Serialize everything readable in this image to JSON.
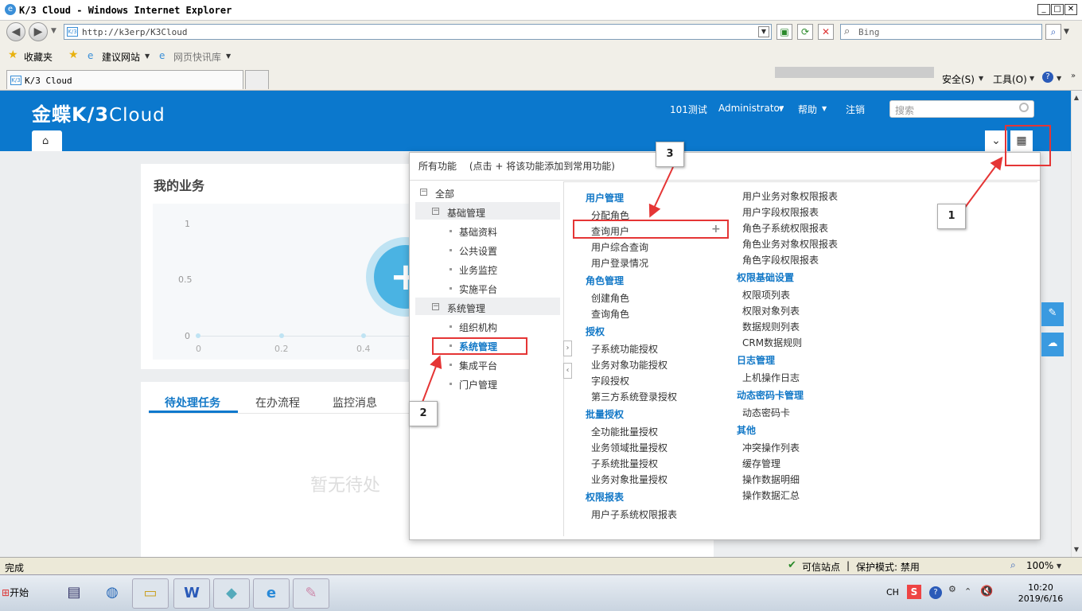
{
  "browser": {
    "title": "K/3 Cloud - Windows Internet Explorer",
    "address": "http://k3erp/K3Cloud",
    "search_placeholder": "Bing",
    "favorites": "收藏夹",
    "fav_links": [
      "建议网站",
      "网页快讯库"
    ],
    "tab_title": "K/3 Cloud",
    "tools": [
      "安全(S)",
      "工具(O)"
    ],
    "status_text": "完成",
    "zone": "可信站点",
    "protected_mode": "保护模式: 禁用",
    "zoom": "100%"
  },
  "app": {
    "logo_cn": "金蝶",
    "logo_en": "K/3",
    "logo_cloud": "Cloud",
    "account": "101测试",
    "user": "Administrator",
    "help": "帮助",
    "logout": "注销",
    "search_placeholder": "搜索"
  },
  "business": {
    "title": "我的业务",
    "y_ticks": [
      "1",
      "0.5",
      "0"
    ],
    "x_ticks": [
      "0",
      "0.2",
      "0.4"
    ],
    "plus": "+"
  },
  "tasks": {
    "tabs": [
      "待处理任务",
      "在办流程",
      "监控消息"
    ],
    "empty": "暂无待处"
  },
  "popup": {
    "title": "所有功能",
    "hint": "(点击 + 将该功能添加到常用功能)",
    "tree": {
      "root": "全部",
      "groups": [
        {
          "label": "基础管理",
          "items": [
            "基础资料",
            "公共设置",
            "业务监控",
            "实施平台"
          ]
        },
        {
          "label": "系统管理",
          "items": [
            "组织机构",
            "系统管理",
            "集成平台",
            "门户管理"
          ]
        }
      ]
    },
    "col1": [
      {
        "cat": "用户管理",
        "items": [
          "分配角色",
          "查询用户",
          "用户综合查询",
          "用户登录情况"
        ]
      },
      {
        "cat": "角色管理",
        "items": [
          "创建角色",
          "查询角色"
        ]
      },
      {
        "cat": "授权",
        "items": [
          "子系统功能授权",
          "业务对象功能授权",
          "字段授权",
          "第三方系统登录授权"
        ]
      },
      {
        "cat": "批量授权",
        "items": [
          "全功能批量授权",
          "业务领域批量授权",
          "子系统批量授权",
          "业务对象批量授权"
        ]
      },
      {
        "cat": "权限报表",
        "items": [
          "用户子系统权限报表"
        ]
      }
    ],
    "col2_top": [
      "用户业务对象权限报表",
      "用户字段权限报表",
      "角色子系统权限报表",
      "角色业务对象权限报表",
      "角色字段权限报表"
    ],
    "col2": [
      {
        "cat": "权限基础设置",
        "items": [
          "权限项列表",
          "权限对象列表",
          "数据规则列表",
          "CRM数据规则"
        ]
      },
      {
        "cat": "日志管理",
        "items": [
          "上机操作日志"
        ]
      },
      {
        "cat": "动态密码卡管理",
        "items": [
          "动态密码卡"
        ]
      },
      {
        "cat": "其他",
        "items": [
          "冲突操作列表",
          "缓存管理",
          "操作数据明细",
          "操作数据汇总"
        ]
      }
    ],
    "add_icon": "+"
  },
  "callouts": [
    "1",
    "2",
    "3"
  ],
  "taskbar": {
    "start": "开始",
    "lang": "CH",
    "time": "10:20",
    "date": "2019/6/16"
  }
}
